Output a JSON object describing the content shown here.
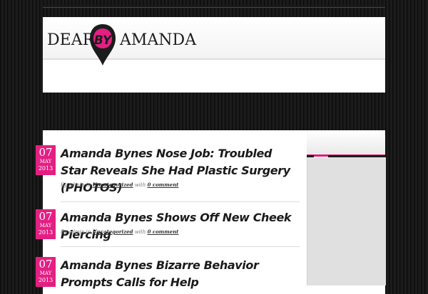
{
  "header": {
    "logo": {
      "word_left": "DEAR",
      "word_right": "AMANDA",
      "badge": "BY"
    }
  },
  "posts": [
    {
      "date": {
        "day": "07",
        "month": "MAY",
        "year": "2013"
      },
      "title": "Amanda Bynes Nose Job: Troubled Star Reveals She Had Plastic Surgery (PHOTOS)",
      "meta": {
        "by": "By",
        "author": "admin",
        "in": "in",
        "category": "Uncategorized",
        "with": "with",
        "comments": "0 comment"
      }
    },
    {
      "date": {
        "day": "07",
        "month": "MAY",
        "year": "2013"
      },
      "title": "Amanda Bynes Shows Off New Cheek Piercing",
      "meta": {
        "by": "By",
        "author": "admin",
        "in": "in",
        "category": "Uncategorized",
        "with": "with",
        "comments": "0 comment"
      }
    },
    {
      "date": {
        "day": "07",
        "month": "MAY",
        "year": "2013"
      },
      "title": "Amanda Bynes Bizarre Behavior Prompts Calls for Help"
    }
  ],
  "colors": {
    "accent": "#e41f83",
    "background": "#151515",
    "panel": "#ffffff"
  }
}
